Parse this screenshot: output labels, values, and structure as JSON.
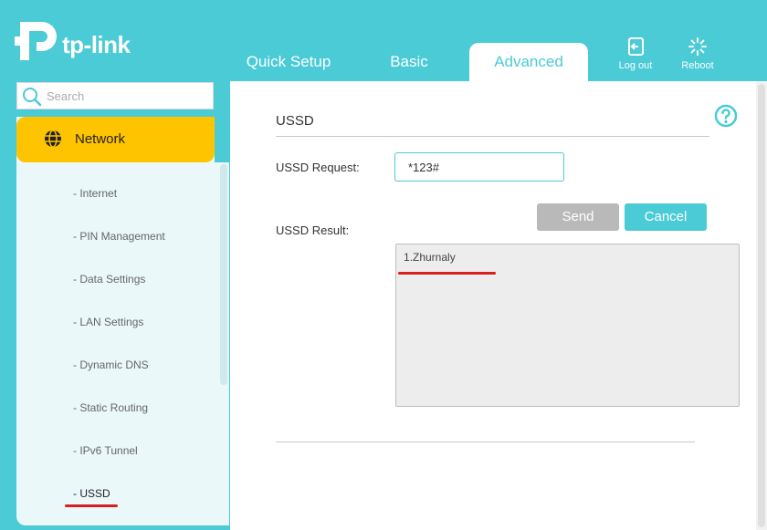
{
  "brand": {
    "name": "tp-link"
  },
  "tabs": [
    {
      "label": "Quick Setup"
    },
    {
      "label": "Basic"
    },
    {
      "label": "Advanced"
    }
  ],
  "header_actions": {
    "logout_label": "Log out",
    "reboot_label": "Reboot"
  },
  "search": {
    "placeholder": "Search"
  },
  "sidebar": {
    "section": {
      "label": "Network",
      "icon": "globe-icon"
    },
    "items": [
      {
        "label": "- Internet"
      },
      {
        "label": "- PIN Management"
      },
      {
        "label": "- Data Settings"
      },
      {
        "label": "- LAN Settings"
      },
      {
        "label": "- Dynamic DNS"
      },
      {
        "label": "- Static Routing"
      },
      {
        "label": "- IPv6 Tunnel"
      },
      {
        "label": "- USSD"
      }
    ]
  },
  "main": {
    "title": "USSD",
    "request_label": "USSD Request:",
    "request_value": "*123#",
    "result_label": "USSD Result:",
    "send_label": "Send",
    "cancel_label": "Cancel",
    "result_text": "1.Zhurnaly"
  },
  "colors": {
    "accent": "#4acbd6",
    "active_menu": "#ffc400",
    "highlight_mark": "#d81e1e"
  }
}
